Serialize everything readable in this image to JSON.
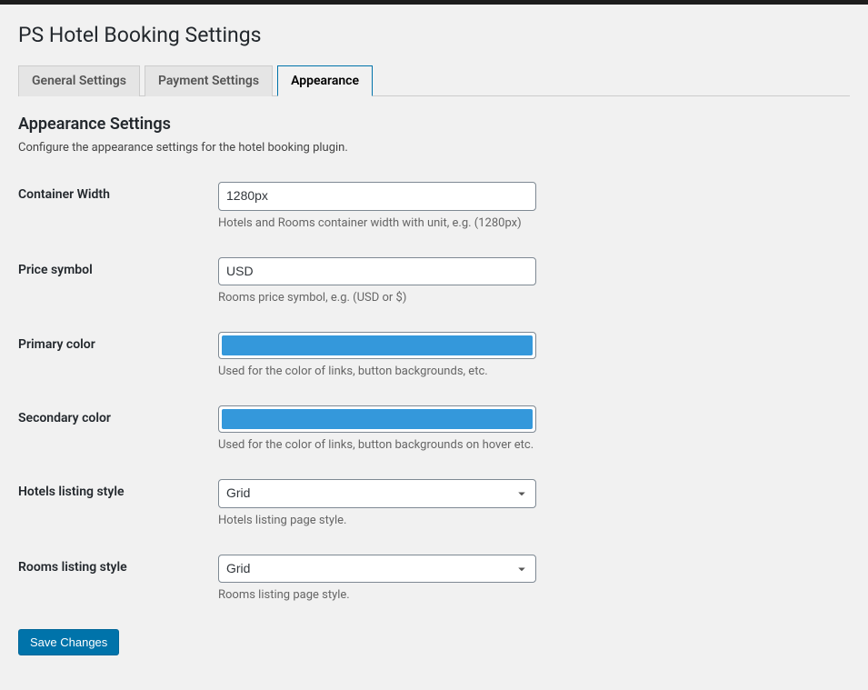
{
  "page": {
    "title": "PS Hotel Booking Settings"
  },
  "tabs": [
    {
      "label": "General Settings",
      "active": false
    },
    {
      "label": "Payment Settings",
      "active": false
    },
    {
      "label": "Appearance",
      "active": true
    }
  ],
  "section": {
    "title": "Appearance Settings",
    "description": "Configure the appearance settings for the hotel booking plugin."
  },
  "fields": {
    "container_width": {
      "label": "Container Width",
      "value": "1280px",
      "description": "Hotels and Rooms container width with unit, e.g. (1280px)"
    },
    "price_symbol": {
      "label": "Price symbol",
      "value": "USD",
      "description": "Rooms price symbol, e.g. (USD or $)"
    },
    "primary_color": {
      "label": "Primary color",
      "value": "#3498db",
      "description": "Used for the color of links, button backgrounds, etc."
    },
    "secondary_color": {
      "label": "Secondary color",
      "value": "#3498db",
      "description": "Used for the color of links, button backgrounds on hover etc."
    },
    "hotels_listing": {
      "label": "Hotels listing style",
      "value": "Grid",
      "description": "Hotels listing page style."
    },
    "rooms_listing": {
      "label": "Rooms listing style",
      "value": "Grid",
      "description": "Rooms listing page style."
    }
  },
  "actions": {
    "save_label": "Save Changes"
  }
}
